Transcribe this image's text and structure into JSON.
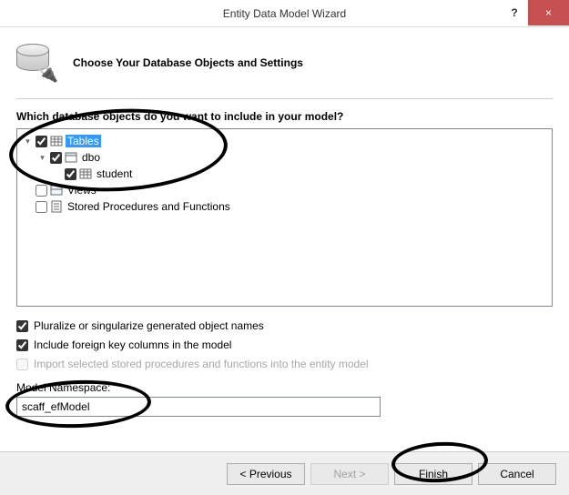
{
  "titlebar": {
    "title": "Entity Data Model Wizard",
    "help": "?",
    "close": "×"
  },
  "header": {
    "heading": "Choose Your Database Objects and Settings"
  },
  "prompt": "Which database objects do you want to include in your model?",
  "tree": {
    "tables": {
      "label": "Tables",
      "checked": true,
      "expanded": true
    },
    "dbo": {
      "label": "dbo",
      "checked": true,
      "expanded": true
    },
    "student": {
      "label": "student",
      "checked": true
    },
    "views": {
      "label": "Views",
      "checked": false,
      "expanded": false
    },
    "sprocs": {
      "label": "Stored Procedures and Functions",
      "checked": false,
      "expanded": false
    }
  },
  "options": {
    "pluralize": {
      "label": "Pluralize or singularize generated object names",
      "checked": true
    },
    "fk": {
      "label": "Include foreign key columns in the model",
      "checked": true
    },
    "importSp": {
      "label": "Import selected stored procedures and functions into the entity model",
      "checked": false
    }
  },
  "namespace": {
    "label": "Model Namespace:",
    "value": "scaff_efModel"
  },
  "footer": {
    "previous": "< Previous",
    "next": "Next >",
    "finish": "Finish",
    "cancel": "Cancel"
  }
}
